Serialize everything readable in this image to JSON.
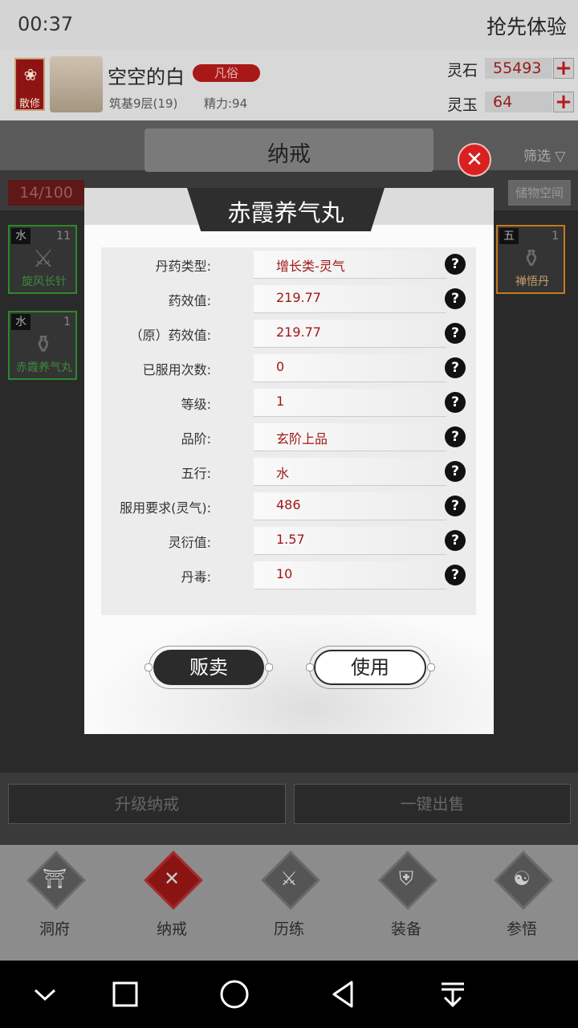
{
  "status": {
    "time": "00:37",
    "trial": "抢先体验"
  },
  "profile": {
    "badge_label": "散修",
    "name": "空空的白",
    "rank": "凡俗",
    "realm": "筑基9层(19)",
    "energy": "精力:94",
    "spirit_stone_label": "灵石",
    "spirit_stone_value": "55493",
    "spirit_jade_label": "灵玉",
    "spirit_jade_value": "64",
    "plus_glyph": "+"
  },
  "ring": {
    "title": "纳戒",
    "filter": "筛选",
    "count": "14/100",
    "storage": "储物空间"
  },
  "items": [
    {
      "element": "水",
      "count": "11",
      "name": "旋风长针"
    },
    {
      "element": "水",
      "count": "1",
      "name": "赤霞养气丸"
    },
    {
      "element": "五",
      "count": "1",
      "name": "禅悟丹"
    }
  ],
  "bottom_buttons": {
    "upgrade": "升级纳戒",
    "sell_all": "一键出售"
  },
  "tabs": [
    {
      "label": "洞府",
      "icon": "cave-icon"
    },
    {
      "label": "纳戒",
      "icon": "ring-icon"
    },
    {
      "label": "历练",
      "icon": "swords-icon"
    },
    {
      "label": "装备",
      "icon": "armor-icon"
    },
    {
      "label": "参悟",
      "icon": "book-icon"
    }
  ],
  "dialog": {
    "title": "赤霞养气丸",
    "rows": [
      {
        "label": "丹药类型:",
        "value": "增长类-灵气"
      },
      {
        "label": "药效值:",
        "value": "219.77"
      },
      {
        "label": "（原）药效值:",
        "value": "219.77"
      },
      {
        "label": "已服用次数:",
        "value": "0"
      },
      {
        "label": "等级:",
        "value": "1"
      },
      {
        "label": "品阶:",
        "value": "玄阶上品"
      },
      {
        "label": "五行:",
        "value": "水"
      },
      {
        "label": "服用要求(灵气):",
        "value": "486"
      },
      {
        "label": "灵衍值:",
        "value": "1.57"
      },
      {
        "label": "丹毒:",
        "value": "10"
      }
    ],
    "help_glyph": "?",
    "sell": "贩卖",
    "use": "使用"
  },
  "colors": {
    "accent_red": "#a01818",
    "close_red": "#d92020",
    "item_green": "#2a8a2a",
    "item_orange": "#c57a1e"
  }
}
